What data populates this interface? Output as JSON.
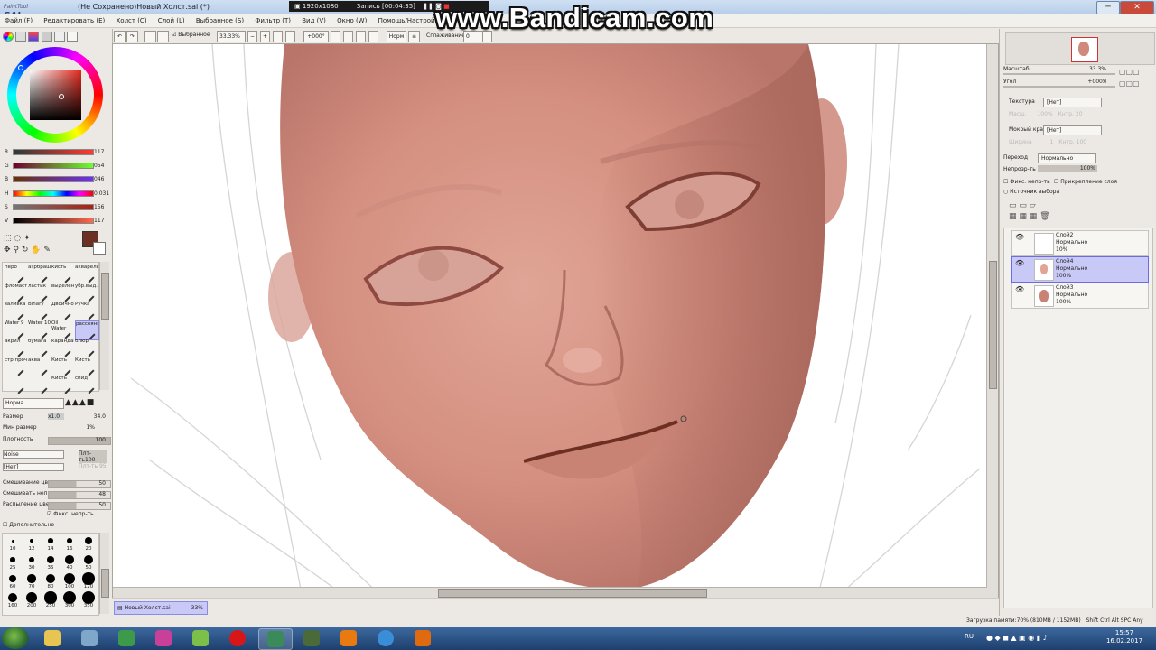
{
  "titlebar": {
    "app_name": "PaintTool",
    "app_logo": "SAI",
    "title": "(Не Сохранено)Новый Холст.sai (*)",
    "btn_min": "─",
    "btn_max": "□",
    "btn_close": "✕"
  },
  "recorder": {
    "resolution": "1920x1080",
    "recording": "Запись [00:04:35]"
  },
  "watermark": "www.Bandicam.com",
  "menu": [
    "Файл (F)",
    "Редактировать (E)",
    "Холст (C)",
    "Слой (L)",
    "Выбранное (S)",
    "Фильтр (T)",
    "Вид (V)",
    "Окно (W)",
    "Помощь/Настройки (H)"
  ],
  "toolbar": {
    "selection_label": "Выбранное",
    "zoom": "33.33%",
    "rotation": "+000°",
    "blend": "Норм",
    "smoothing_label": "Сглаживание",
    "smoothing_value": "0"
  },
  "color": {
    "current": "#6e2f23",
    "r_label": "R",
    "r": "117",
    "g_label": "G",
    "g": "054",
    "b_label": "B",
    "b": "046",
    "h_label": "H",
    "h": "0.031",
    "s_label": "S",
    "s": "156",
    "v_label": "V",
    "v": "117"
  },
  "tools": [
    "перо",
    "аэрбраш",
    "кисть",
    "акварель",
    "фломастер",
    "ластик",
    "выделение",
    "убр.выд.",
    "заливка",
    "Binary",
    "Двоичное",
    "Ручка",
    "Water 9",
    "Water 10",
    "Oil Water",
    "рассеяние",
    "акрил",
    "бумага",
    "карандаш",
    "блюр",
    "стр.прочее",
    "аква",
    "Кисть",
    "Кисть",
    "",
    "",
    "Кисть",
    "спид"
  ],
  "brush": {
    "mode": "Норма",
    "size_label": "Размер",
    "size_mult": "x1.0",
    "size": "34.0",
    "min_size_label": "Мин размер",
    "min_size": "1%",
    "density_label": "Плотность",
    "density": "100",
    "texture_label": "Noise",
    "texture_strength": "Плт-ть100",
    "shape_label": "[Нет]",
    "shape_value": "Плт-ть 95",
    "blend_label": "Смешивание цвета",
    "blend": "50",
    "dilution_label": "Смешивать непр.",
    "dilution": "48",
    "persistence_label": "Распыление цвета",
    "persistence": "50",
    "keep_opacity": "Фикс. непр-ть",
    "advanced": "Дополнительно",
    "sizes": [
      "10",
      "12",
      "14",
      "16",
      "20",
      "25",
      "30",
      "35",
      "40",
      "50",
      "60",
      "70",
      "80",
      "100",
      "120",
      "160",
      "200",
      "250",
      "300",
      "350"
    ]
  },
  "navigator": {
    "zoom_label": "Масштаб",
    "zoom": "33.3%",
    "angle_label": "Угол",
    "angle": "+000Я"
  },
  "layer_props": {
    "texture_label": "Текстура",
    "texture": "[Нет]",
    "scale": "Масш.",
    "scale_val": "100%",
    "strength": "Кнтр.",
    "strength_val": "20",
    "wet_edge_label": "Мокрый край",
    "wet_edge": "[Нет]",
    "width": "Ширина",
    "width_val": "1",
    "strength2": "Кнтр.",
    "strength2_val": "100",
    "blend_label": "Переход",
    "blend": "Нормально",
    "opacity_label": "Непрозр-ть",
    "opacity": "100%",
    "keep_opacity": "Фикс. непр-ть",
    "clip": "Прикрепление слоя",
    "selection_source": "Источник выбора"
  },
  "layers": [
    {
      "name": "Слой2",
      "mode": "Нормально",
      "opacity": "10%",
      "selected": false
    },
    {
      "name": "Слой4",
      "mode": "Нормально",
      "opacity": "100%",
      "selected": true
    },
    {
      "name": "Слой3",
      "mode": "Нормально",
      "opacity": "100%",
      "selected": false
    }
  ],
  "doc_tab": {
    "name": "Новый Холст.sai",
    "zoom": "33%"
  },
  "status": {
    "memory": "Загрузка памяти:70% (810MB / 1152MB)",
    "keys": "Shift Ctrl Alt SPC Any"
  },
  "taskbar": {
    "lang": "RU",
    "time": "15:57",
    "date": "16.02.2017",
    "apps": [
      "explorer",
      "settings",
      "sai-green",
      "winword",
      "sai-leaf",
      "opera",
      "active-app",
      "minecraft",
      "paint",
      "chrome",
      "firefox"
    ]
  },
  "colors": {
    "skin_base": "#d8968a",
    "skin_dark": "#a8665a",
    "lip": "#7a3a30",
    "selection": "#c9c9f7"
  }
}
